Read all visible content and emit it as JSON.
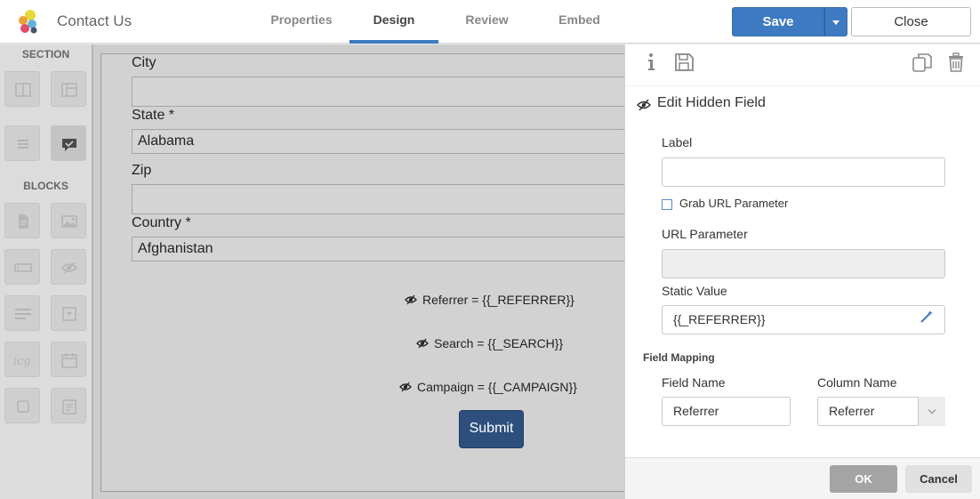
{
  "app": {
    "title": "Contact Us",
    "logo_icon": "app-logo-icon"
  },
  "tabs": [
    {
      "label": "Properties",
      "active": false
    },
    {
      "label": "Design",
      "active": true
    },
    {
      "label": "Review",
      "active": false
    },
    {
      "label": "Embed",
      "active": false
    }
  ],
  "toolbar": {
    "save_label": "Save",
    "close_label": "Close"
  },
  "palette": {
    "section_heading": "SECTION",
    "blocks_heading": "BLOCKS"
  },
  "form": {
    "fields": [
      {
        "label": "City",
        "value": ""
      },
      {
        "label": "State *",
        "value": "Alabama"
      },
      {
        "label": "Zip",
        "value": ""
      },
      {
        "label": "Country *",
        "value": "Afghanistan"
      }
    ],
    "hidden_fields": [
      "Referrer = {{_REFERRER}}",
      "Search = {{_SEARCH}}",
      "Campaign = {{_CAMPAIGN}}"
    ],
    "submit_label": "Submit"
  },
  "panel": {
    "title": "Edit Hidden Field",
    "label_caption": "Label",
    "label_value": "",
    "grab_url_label": "Grab URL Parameter",
    "grab_url_checked": false,
    "url_param_caption": "URL Parameter",
    "url_param_value": "",
    "static_value_caption": "Static Value",
    "static_value": "{{_REFERRER}}",
    "field_mapping_title": "Field Mapping",
    "field_name_caption": "Field Name",
    "field_name_value": "Referrer",
    "column_name_caption": "Column Name",
    "column_name_value": "Referrer",
    "ok_label": "OK",
    "cancel_label": "Cancel"
  },
  "colors": {
    "accent": "#3d7ac2",
    "submit": "#2e4f7e"
  }
}
